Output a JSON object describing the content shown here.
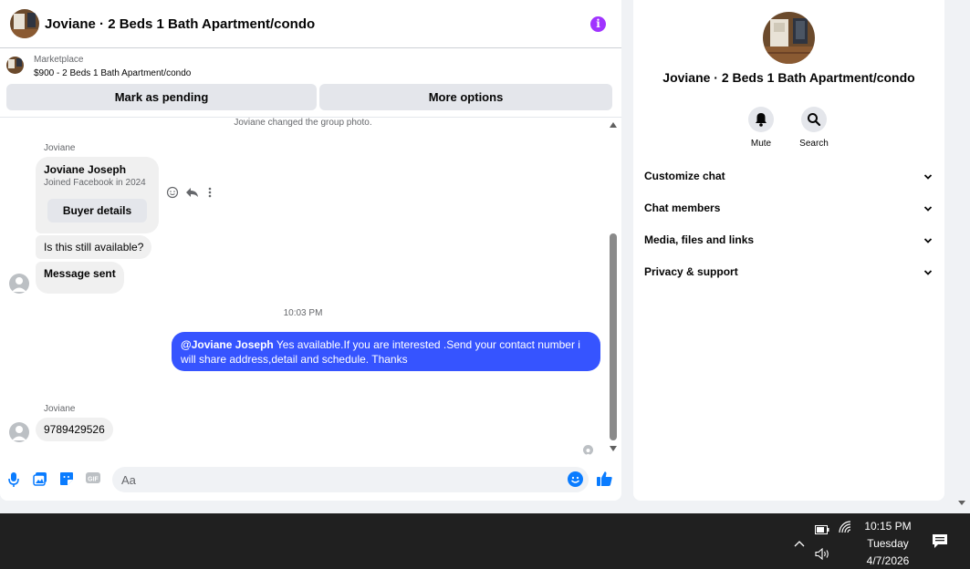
{
  "chat": {
    "title": "Joviane · 2 Beds 1 Bath Apartment/condo",
    "marketplace_label": "Marketplace",
    "listing": "$900 - 2 Beds 1 Bath Apartment/condo",
    "mark_pending_label": "Mark as pending",
    "more_options_label": "More options"
  },
  "messages": {
    "system_note": "Joviane changed the group photo.",
    "sender_1": "Joviane",
    "card_name": "Joviane Joseph",
    "card_sub": "Joined Facebook in 2024",
    "card_button": "Buyer details",
    "msg_available": "Is this still available?",
    "msg_sent": "Message sent",
    "timestamp": "10:03 PM",
    "outgoing_mention": "@Joviane Joseph",
    "outgoing_text": " Yes available.If you are interested .Send your contact number i will share address,detail and schedule. Thanks",
    "sender_2": "Joviane",
    "msg_number": "9789429526"
  },
  "composer": {
    "placeholder": "Aa"
  },
  "info_panel": {
    "title": "Joviane · 2 Beds 1 Bath Apartment/condo",
    "mute_label": "Mute",
    "search_label": "Search",
    "sections": [
      "Customize chat",
      "Chat members",
      "Media, files and links",
      "Privacy & support"
    ]
  },
  "taskbar": {
    "time": "10:15 PM",
    "day": "Tuesday",
    "date": "4/7/2026"
  },
  "colors": {
    "accent": "#0a7cff",
    "outgoing_bubble": "#3654ff",
    "info_icon": "#a033ff"
  }
}
